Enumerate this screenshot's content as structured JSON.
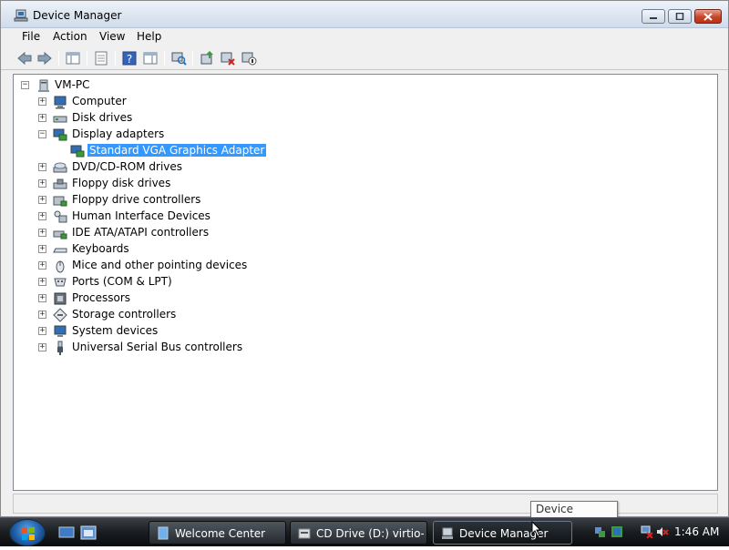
{
  "window": {
    "title": "Device Manager",
    "accent": "#3399ff"
  },
  "menu": [
    "File",
    "Action",
    "View",
    "Help"
  ],
  "toolbar_icons": [
    "back-arrow-icon",
    "forward-arrow-icon",
    "show-hide-tree-icon",
    "properties-icon",
    "help-icon",
    "action-pane-icon",
    "scan-hardware-icon",
    "update-driver-icon",
    "uninstall-icon",
    "disable-device-icon"
  ],
  "tree": {
    "root": "VM-PC",
    "categories": [
      {
        "label": "Computer",
        "icon": "computer-icon",
        "expanded": false
      },
      {
        "label": "Disk drives",
        "icon": "disk-drive-icon",
        "expanded": false
      },
      {
        "label": "Display adapters",
        "icon": "display-adapter-icon",
        "expanded": true,
        "children": [
          "Standard VGA Graphics Adapter"
        ]
      },
      {
        "label": "DVD/CD-ROM drives",
        "icon": "dvd-drive-icon",
        "expanded": false
      },
      {
        "label": "Floppy disk drives",
        "icon": "floppy-drive-icon",
        "expanded": false
      },
      {
        "label": "Floppy drive controllers",
        "icon": "floppy-controller-icon",
        "expanded": false
      },
      {
        "label": "Human Interface Devices",
        "icon": "hid-icon",
        "expanded": false
      },
      {
        "label": "IDE ATA/ATAPI controllers",
        "icon": "ide-controller-icon",
        "expanded": false
      },
      {
        "label": "Keyboards",
        "icon": "keyboard-icon",
        "expanded": false
      },
      {
        "label": "Mice and other pointing devices",
        "icon": "mouse-icon",
        "expanded": false
      },
      {
        "label": "Ports (COM & LPT)",
        "icon": "port-icon",
        "expanded": false
      },
      {
        "label": "Processors",
        "icon": "processor-icon",
        "expanded": false
      },
      {
        "label": "Storage controllers",
        "icon": "storage-controller-icon",
        "expanded": false
      },
      {
        "label": "System devices",
        "icon": "system-device-icon",
        "expanded": false
      },
      {
        "label": "Universal Serial Bus controllers",
        "icon": "usb-icon",
        "expanded": false
      }
    ],
    "selected": "Standard VGA Graphics Adapter"
  },
  "tooltip": "Device Manager",
  "taskbar": {
    "buttons": [
      {
        "label": "Welcome Center",
        "icon": "welcome-center-icon",
        "active": false
      },
      {
        "label": "CD Drive (D:) virtio-...",
        "icon": "cd-drive-icon",
        "active": false
      },
      {
        "label": "Device Manager",
        "icon": "device-manager-icon",
        "active": true
      }
    ],
    "clock": "1:46 AM",
    "tray_icons": [
      "network-icon",
      "network-error-icon",
      "volume-muted-icon"
    ]
  }
}
